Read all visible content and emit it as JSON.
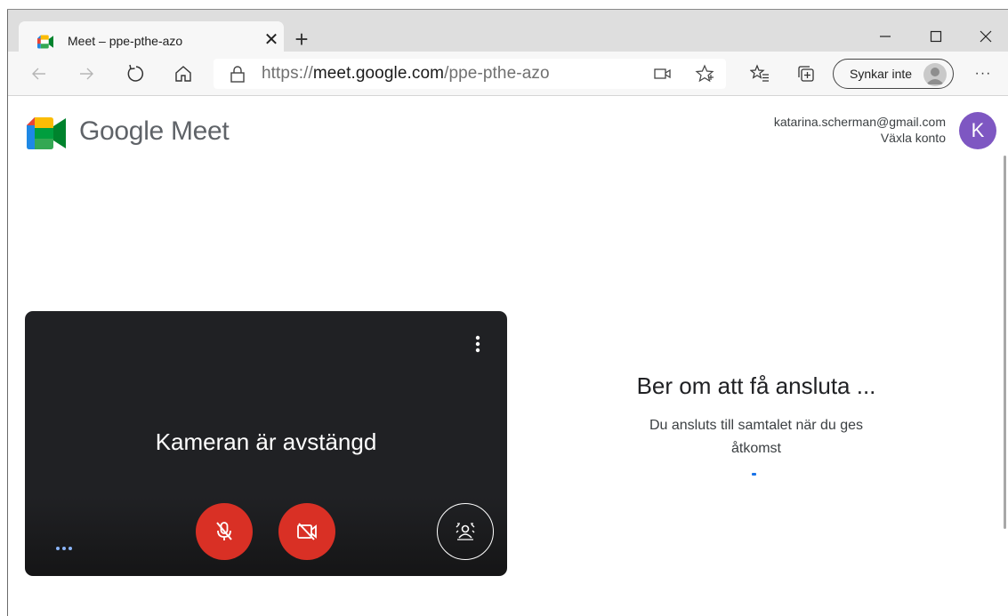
{
  "browser": {
    "tab": {
      "title": "Meet – ppe-pthe-azo",
      "close_glyph": "✕"
    },
    "new_tab_glyph": "+",
    "window_controls": {
      "minimize": "—",
      "maximize": "☐",
      "close": "✕"
    },
    "address": {
      "scheme": "https://",
      "host": "meet.google.com",
      "path": "/ppe-pthe-azo"
    },
    "sync_label": "Synkar inte",
    "more_glyph": "···",
    "icons": [
      "back-icon",
      "forward-icon",
      "refresh-icon",
      "home-icon",
      "lock-icon",
      "camera-icon",
      "star-icon",
      "favorites-icon",
      "collections-icon",
      "profile-icon"
    ]
  },
  "meet": {
    "brand": "Google Meet",
    "account": {
      "email": "katarina.scherman@gmail.com",
      "switch_label": "Växla konto",
      "avatar_letter": "K",
      "avatar_color": "#7e57c2"
    },
    "preview": {
      "camera_off_text": "Kameran är avstängd",
      "mic_state": "off",
      "camera_state": "off",
      "button_color": "#d93025"
    },
    "join": {
      "title": "Ber om att få ansluta ...",
      "subtitle": "Du ansluts till samtalet när du ges åtkomst"
    }
  }
}
